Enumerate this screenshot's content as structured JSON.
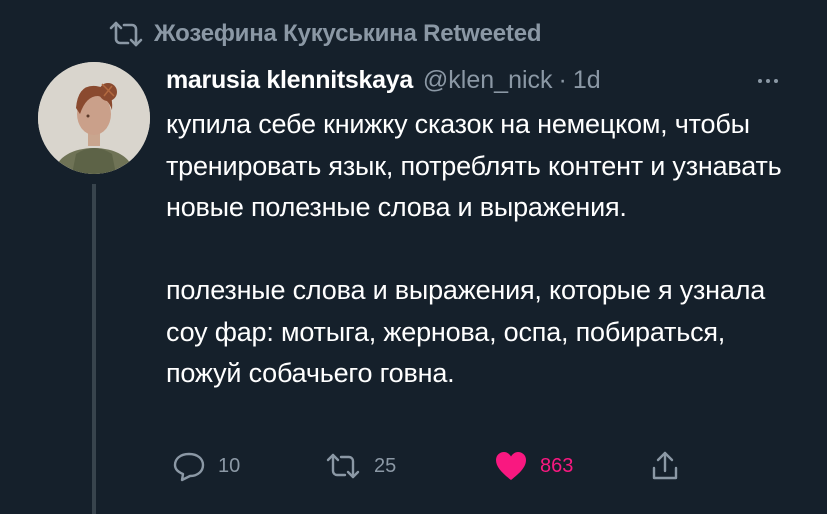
{
  "retweet_banner": {
    "text": "Жозефина Кукуськина Retweeted",
    "icon": "retweet-icon"
  },
  "tweet": {
    "author": {
      "name": "marusia klennitskaya",
      "handle": "@klen_nick",
      "separator": "·",
      "time": "1d",
      "avatar": "avatar"
    },
    "paragraphs": [
      "купила себе книжку сказок на немецком, чтобы тренировать язык, потреблять контент и узнавать новые полезные слова и выражения.",
      "полезные слова и выражения, которые я узнала соу фар: мотыга, жернова, оспа, побираться, пожуй собачьего говна."
    ],
    "actions": {
      "replies": "10",
      "retweets": "25",
      "likes": "863",
      "liked": true
    }
  },
  "colors": {
    "background": "#15202b",
    "text": "#ffffff",
    "secondary": "#8b98a5",
    "like": "#f91880",
    "thread_line": "#38444d"
  }
}
